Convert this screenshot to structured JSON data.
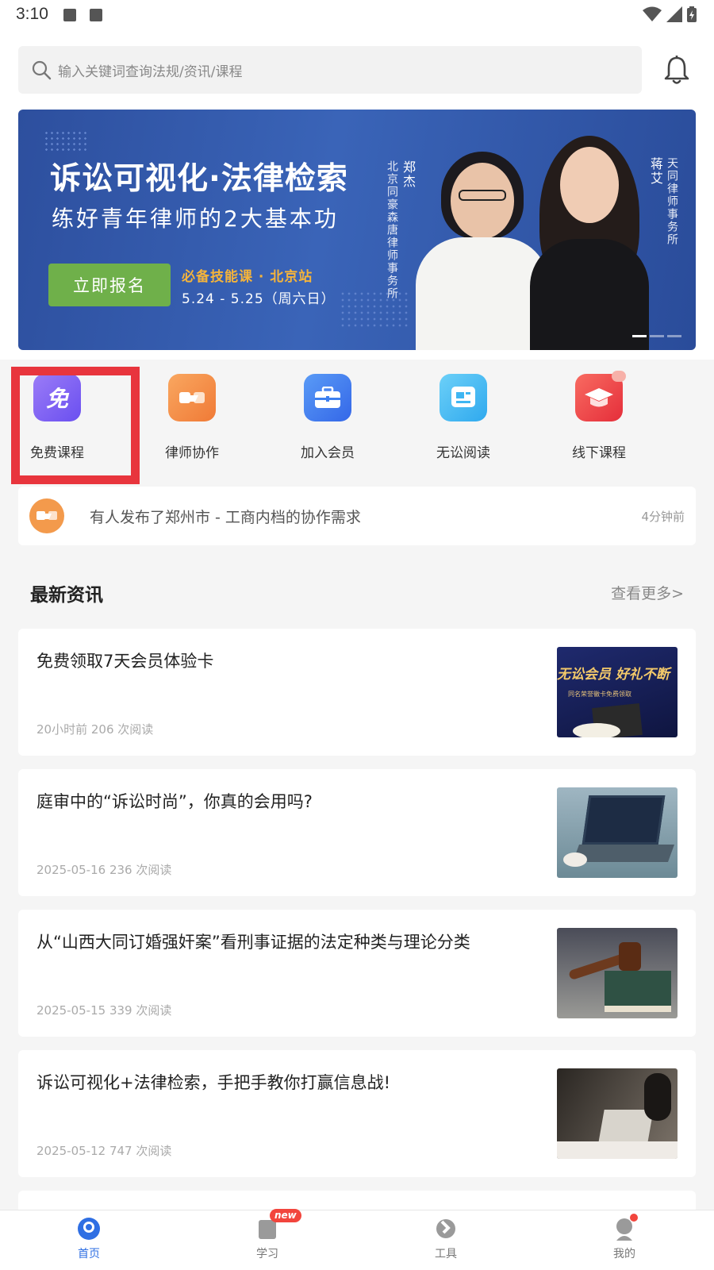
{
  "status_bar": {
    "time": "3:10"
  },
  "header": {
    "search_placeholder": "输入关键词查询法规/资讯/课程"
  },
  "banner": {
    "title": "诉讼可视化·法律检索",
    "subtitle": "练好青年律师的2大基本功",
    "button": "立即报名",
    "tag": "必备技能课 · 北京站",
    "date": "5.24 - 5.25（周六日）",
    "lecturer1_name": "郑杰",
    "lecturer1_firm": "北京同豪森唐律师事务所",
    "lecturer2_name": "蒋艾",
    "lecturer2_firm": "天同律师事务所"
  },
  "quick_menu": [
    {
      "label": "免费课程",
      "icon": "free-course-icon",
      "glyph": "免",
      "color": "#7b5cf0"
    },
    {
      "label": "律师协作",
      "icon": "handshake-icon",
      "color": "#f3843c"
    },
    {
      "label": "加入会员",
      "icon": "briefcase-icon",
      "color": "#3d7ff0"
    },
    {
      "label": "无讼阅读",
      "icon": "reading-icon",
      "color": "#3fb6f2"
    },
    {
      "label": "线下课程",
      "icon": "graduation-cap-icon",
      "color": "#ef3f46"
    }
  ],
  "notice": {
    "text": "有人发布了郑州市 - 工商内档的协作需求",
    "time": "4分钟前"
  },
  "news_section": {
    "title": "最新资讯",
    "more": "查看更多>"
  },
  "news": [
    {
      "title": "免费领取7天会员体验卡",
      "meta": "20小时前 206 次阅读",
      "thumb_text": "无讼会员 好礼不断",
      "thumb_sub": "同名荣誉徽卡免费领取"
    },
    {
      "title": "庭审中的“诉讼时尚”，你真的会用吗?",
      "meta": "2025-05-16 236 次阅读"
    },
    {
      "title": "从“山西大同订婚强奸案”看刑事证据的法定种类与理论分类",
      "meta": "2025-05-15 339 次阅读"
    },
    {
      "title": "诉讼可视化+法律检索，手把手教你打赢信息战!",
      "meta": "2025-05-12 747 次阅读"
    }
  ],
  "tab_bar": [
    {
      "label": "首页",
      "icon": "home-icon",
      "active": true
    },
    {
      "label": "学习",
      "icon": "book-icon",
      "badge": "new"
    },
    {
      "label": "工具",
      "icon": "wrench-icon"
    },
    {
      "label": "我的",
      "icon": "profile-icon"
    }
  ],
  "colors": {
    "accent": "#2f6fe3",
    "highlight": "#e8353d"
  }
}
